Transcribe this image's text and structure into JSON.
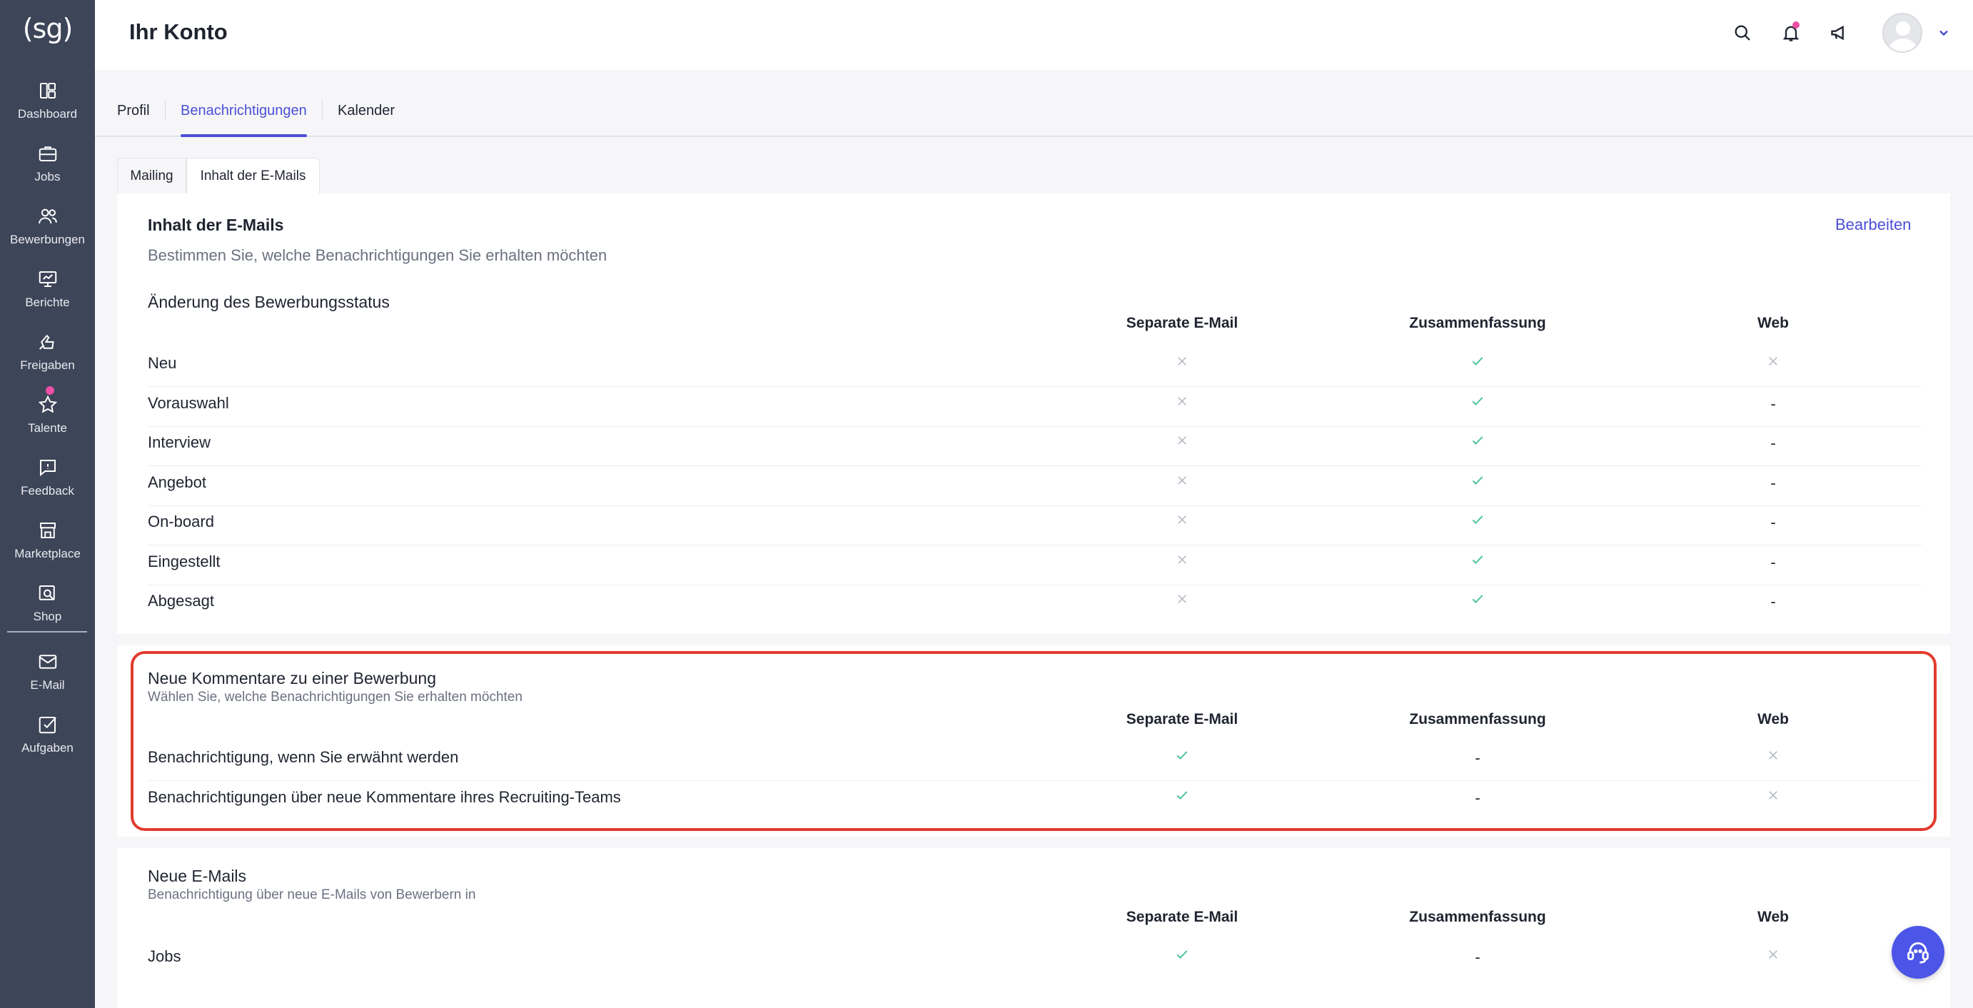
{
  "sidebar": {
    "logo": "(sg)",
    "items": [
      {
        "label": "Dashboard"
      },
      {
        "label": "Jobs"
      },
      {
        "label": "Bewerbungen"
      },
      {
        "label": "Berichte"
      },
      {
        "label": "Freigaben"
      },
      {
        "label": "Talente"
      },
      {
        "label": "Feedback"
      },
      {
        "label": "Marketplace"
      },
      {
        "label": "Shop"
      },
      {
        "label": "E-Mail"
      },
      {
        "label": "Aufgaben"
      }
    ]
  },
  "header": {
    "title": "Ihr Konto"
  },
  "tabs": [
    {
      "label": "Profil"
    },
    {
      "label": "Benachrichtigungen"
    },
    {
      "label": "Kalender"
    }
  ],
  "subtabs": [
    {
      "label": "Mailing"
    },
    {
      "label": "Inhalt der E-Mails"
    }
  ],
  "card": {
    "title": "Inhalt der E-Mails",
    "subtitle": "Bestimmen Sie, welche Benachrichtigungen Sie erhalten möchten",
    "edit_label": "Bearbeiten"
  },
  "columns": [
    "Separate E-Mail",
    "Zusammenfassung",
    "Web"
  ],
  "status_section": {
    "title": "Änderung des Bewerbungsstatus",
    "rows": [
      {
        "label": "Neu",
        "cells": [
          "x",
          "check",
          "x"
        ]
      },
      {
        "label": "Vorauswahl",
        "cells": [
          "x",
          "check",
          "-"
        ]
      },
      {
        "label": "Interview",
        "cells": [
          "x",
          "check",
          "-"
        ]
      },
      {
        "label": "Angebot",
        "cells": [
          "x",
          "check",
          "-"
        ]
      },
      {
        "label": "On-board",
        "cells": [
          "x",
          "check",
          "-"
        ]
      },
      {
        "label": "Eingestellt",
        "cells": [
          "x",
          "check",
          "-"
        ]
      },
      {
        "label": "Abgesagt",
        "cells": [
          "x",
          "check",
          "-"
        ]
      }
    ]
  },
  "comments_section": {
    "title": "Neue Kommentare zu einer Bewerbung",
    "subtitle": "Wählen Sie, welche Benachrichtigungen Sie erhalten möchten",
    "rows": [
      {
        "label": "Benachrichtigung, wenn Sie erwähnt werden",
        "cells": [
          "check",
          "-",
          "x"
        ]
      },
      {
        "label": "Benachrichtigungen über neue Kommentare ihres Recruiting-Teams",
        "cells": [
          "check",
          "-",
          "x"
        ]
      }
    ]
  },
  "emails_section": {
    "title": "Neue E-Mails",
    "subtitle": "Benachrichtigung über neue E-Mails von Bewerbern in",
    "rows": [
      {
        "label": "Jobs",
        "cells": [
          "check",
          "-",
          "x"
        ]
      }
    ]
  },
  "colors": {
    "sidebar": "#3d4558",
    "accent": "#4b4fd6",
    "check": "#3fbf96",
    "cross": "#b8bcc6",
    "highlight": "#e23b2e",
    "badge": "#ec4fa5"
  }
}
